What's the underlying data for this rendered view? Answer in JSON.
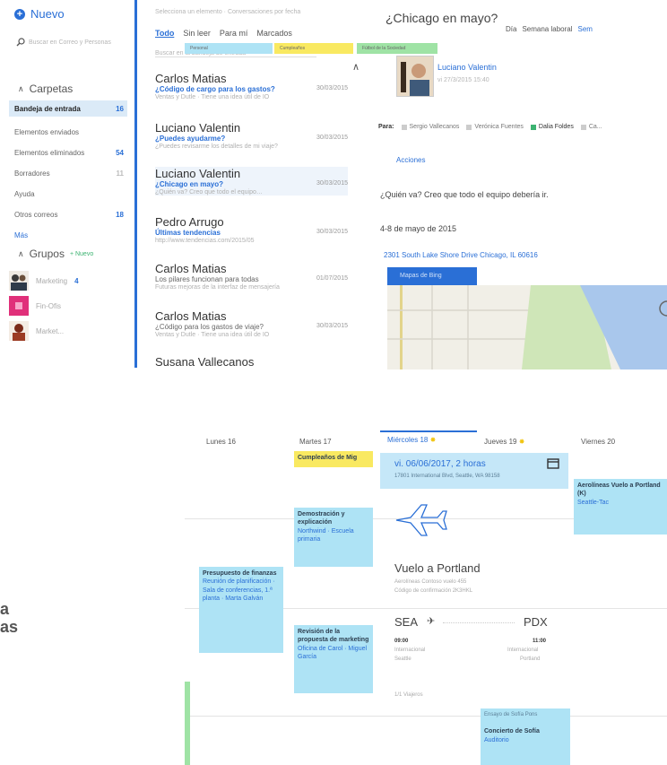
{
  "nav": {
    "new_label": "Nuevo",
    "search_placeholder": "Buscar en Correo y Personas",
    "folders_header": "Carpetas",
    "folders": [
      {
        "label": "Bandeja de entrada",
        "count": "16",
        "selected": true
      },
      {
        "label": "Elementos enviados",
        "count": ""
      },
      {
        "label": "Elementos eliminados",
        "count": "54"
      },
      {
        "label": "Borradores",
        "count": "11"
      },
      {
        "label": "Ayuda",
        "count": ""
      },
      {
        "label": "Otros correos",
        "count": "18"
      },
      {
        "label": "Más",
        "count": ""
      }
    ],
    "groups_header": "Grupos",
    "groups_new": "+ Nuevo",
    "groups": [
      {
        "label": "Marketing",
        "count": "4",
        "avatar": "people-photo"
      },
      {
        "label": "Fin-Ofis",
        "count": "",
        "avatar": "pink-tile"
      },
      {
        "label": "Market...",
        "count": "",
        "avatar": "woman-photo"
      }
    ]
  },
  "list": {
    "filter_text": "Selecciona un elemento · Conversaciones por fecha",
    "tabs": [
      "Todo",
      "Sin leer",
      "Para mí",
      "Marcados"
    ],
    "active_tab": "Todo",
    "search_hint": "Buscar en la bandeja de entrada",
    "messages": [
      {
        "sender": "Carlos Matias",
        "subject": "¿Código de cargo para los gastos?",
        "date": "30/03/2015",
        "preview": "Ventas y Dutle · Tiene una idea útil de IO"
      },
      {
        "sender": "Luciano Valentin",
        "subject": "¿Puedes ayudarme?",
        "date": "30/03/2015",
        "preview": "¿Puedes revisarme los detalles de mi viaje?"
      },
      {
        "sender": "Luciano Valentin",
        "subject": "¿Chicago en mayo?",
        "date": "30/03/2015",
        "preview": "¿Quién va? Creo que todo el equipo…",
        "selected": true
      },
      {
        "sender": "Pedro Arrugo",
        "subject": "Últimas tendencias",
        "date": "30/03/2015",
        "preview": "http://www.tendencias.com/2015/05"
      },
      {
        "sender": "Carlos Matias",
        "subject": "Los pilares funcionan para todas",
        "date": "01/07/2015",
        "preview": "Futuras mejoras de la interfaz de mensajería",
        "plain": true
      },
      {
        "sender": "Carlos Matias",
        "subject": "¿Código para los gastos de viaje?",
        "date": "30/03/2015",
        "preview": "Ventas y Dutle · Tiene una idea útil de IO",
        "plain": true
      },
      {
        "sender": "Susana Vallecanos",
        "subject": "",
        "date": "",
        "preview": ""
      }
    ]
  },
  "reading": {
    "title": "¿Chicago en mayo?",
    "from": "Luciano Valentin",
    "from_sub": "vi 27/3/2015 15:40",
    "to_label": "Para:",
    "recipients": [
      "Sergio Vallecanos",
      "Verónica Fuentes",
      "Dalia Foldes",
      "Ca..."
    ],
    "actions": "Acciones",
    "body": "¿Quién va? Creo que todo el equipo debería ir.",
    "date_line": "4-8 de mayo de 2015",
    "address": "2301 South Lake Shore Drive Chicago, IL 60616",
    "map_tab": "Mapas de Bing"
  },
  "calendar": {
    "views": [
      "Día",
      "Semana laboral",
      "Sem"
    ],
    "active_view": "Sem",
    "legend": [
      {
        "label": "Personal",
        "color": "#aee3f5"
      },
      {
        "label": "Cumpleaños",
        "color": "#f9e961"
      },
      {
        "label": "Fútbol de la Sociedad",
        "color": "#9fe3a5"
      }
    ],
    "days": [
      "Lunes 16",
      "Martes 17",
      "Miércoles 18",
      "Jueves 19",
      "Viernes 20"
    ],
    "today_index": 2,
    "events": {
      "birthday": "Cumpleaños de Mig",
      "demo_title": "Demostración y explicación",
      "demo_sub": "Northwind · Escuela primaria",
      "budget_title": "Presupuesto de finanzas",
      "budget_sub": "Reunión de planificación · Sala de conferencias, 1.ª planta · Marta Galván",
      "review_title": "Revisión de la propuesta de marketing",
      "review_sub": "Oficina de Carol · Miguel García",
      "friday_title": "Aerolíneas Vuelo a Portland (K)",
      "friday_sub": "Seattle-Tac",
      "concert_title": "Concierto de Sofía",
      "concert_sub": "Auditorio",
      "concert_header": "Ensayo de Sofía Pons"
    },
    "flight": {
      "card_time": "vi. 06/06/2017, 2 horas",
      "card_addr": "17801 International Blvd, Seattle, WA 98158",
      "title": "Vuelo a Portland",
      "airline": "Aerolíneas Contoso vuelo 455",
      "confirm": "Código de confirmación 2K3HKL",
      "from_code": "SEA",
      "to_code": "PDX",
      "dep_time": "09:00",
      "arr_time": "11:00",
      "dep_city": "Seattle",
      "arr_city": "Portland",
      "dep_label": "Internacional",
      "arr_label": "Internacional",
      "travelers": "1/1 Viajeros"
    },
    "edge_text_1": "a",
    "edge_text_2": "as"
  }
}
